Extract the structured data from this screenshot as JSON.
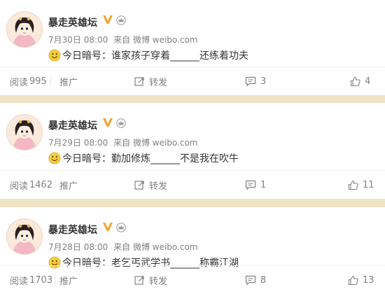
{
  "posts": [
    {
      "username": "暴走英雄坛",
      "time": "7月30日 08:00",
      "source": "来自 微博 weibo.com",
      "content": "今日暗号：谁家孩子穿着______还练着功夫",
      "read_label": "阅读",
      "read_count": "995",
      "promote_label": "推广",
      "forward_label": "转发",
      "comment_count": "3",
      "like_count": "4"
    },
    {
      "username": "暴走英雄坛",
      "time": "7月29日 08:00",
      "source": "来自 微博 weibo.com",
      "content": "今日暗号：勤加修炼______不是我在吹牛",
      "read_label": "阅读",
      "read_count": "1462",
      "promote_label": "推广",
      "forward_label": "转发",
      "comment_count": "1",
      "like_count": "11"
    },
    {
      "username": "暴走英雄坛",
      "time": "7月28日 08:00",
      "source": "来自 微博 weibo.com",
      "content": "今日暗号：老乞丐武学书______称霸江湖",
      "read_label": "阅读",
      "read_count": "1703",
      "promote_label": "推广",
      "forward_label": "转发",
      "comment_count": "8",
      "like_count": "13"
    }
  ],
  "icons": {
    "verified": "verified-v-icon",
    "member": "crown-icon",
    "emoji": "smile-emoji-icon",
    "forward": "forward-icon",
    "comment": "comment-icon",
    "like": "thumbs-up-icon"
  },
  "colors": {
    "background": "#efe3c6",
    "verified": "#f2a52f",
    "meta_text": "#808080",
    "content_text": "#333333"
  }
}
